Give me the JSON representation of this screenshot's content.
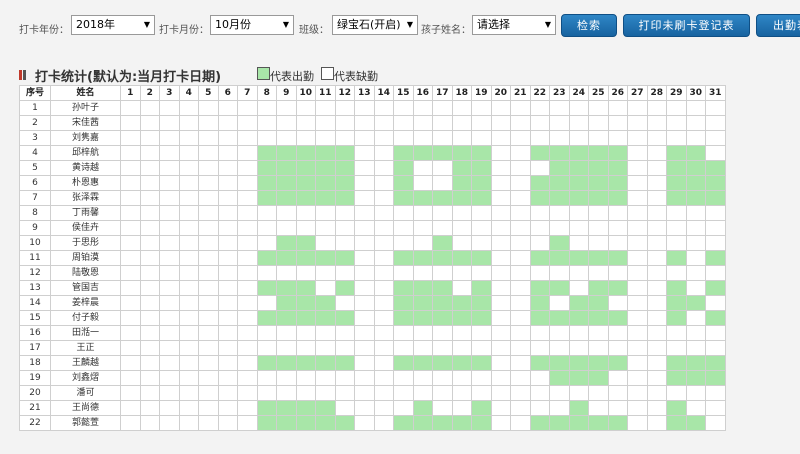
{
  "filters": {
    "year_label": "打卡年份：",
    "year_value": "2018年",
    "month_label": "打卡月份：",
    "month_value": "10月份",
    "class_label": "班级：",
    "class_value": "绿宝石(开启)",
    "child_label": "孩子姓名：",
    "child_value": "请选择"
  },
  "buttons": {
    "search": "检索",
    "print_unpunched": "打印未刷卡登记表",
    "attendance": "出勤表"
  },
  "section": {
    "title": "打卡统计(默认为:当月打卡日期)",
    "legend_present": "代表出勤",
    "legend_absent": "代表缺勤"
  },
  "colors": {
    "present": "#a8e6a8",
    "absent": "#ffffff",
    "button": "#1f6fb0",
    "marker_red": "#c0392b",
    "marker_dark": "#555555"
  },
  "table": {
    "header_index": "序号",
    "header_name": "姓名",
    "days": [
      "1",
      "2",
      "3",
      "4",
      "5",
      "6",
      "7",
      "8",
      "9",
      "10",
      "11",
      "12",
      "13",
      "14",
      "15",
      "16",
      "17",
      "18",
      "19",
      "20",
      "21",
      "22",
      "23",
      "24",
      "25",
      "26",
      "27",
      "28",
      "29",
      "30",
      "31"
    ],
    "rows": [
      {
        "index": "1",
        "name": "孙叶子",
        "present": []
      },
      {
        "index": "2",
        "name": "宋佳茜",
        "present": []
      },
      {
        "index": "3",
        "name": "刘隽嘉",
        "present": []
      },
      {
        "index": "4",
        "name": "邱梓航",
        "present": [
          8,
          9,
          10,
          11,
          12,
          15,
          16,
          17,
          18,
          19,
          22,
          23,
          24,
          25,
          26,
          29,
          30
        ]
      },
      {
        "index": "5",
        "name": "黄诗越",
        "present": [
          8,
          9,
          10,
          11,
          12,
          15,
          18,
          19,
          23,
          24,
          25,
          26,
          29,
          30,
          31
        ]
      },
      {
        "index": "6",
        "name": "朴恩惠",
        "present": [
          8,
          9,
          10,
          11,
          12,
          15,
          18,
          19,
          22,
          23,
          24,
          25,
          26,
          29,
          30,
          31
        ]
      },
      {
        "index": "7",
        "name": "张泽霖",
        "present": [
          8,
          9,
          10,
          11,
          12,
          15,
          16,
          17,
          18,
          19,
          22,
          23,
          24,
          25,
          26,
          29,
          30,
          31
        ]
      },
      {
        "index": "8",
        "name": "丁雨馨",
        "present": []
      },
      {
        "index": "9",
        "name": "侯佳卉",
        "present": []
      },
      {
        "index": "10",
        "name": "于思彤",
        "present": [
          9,
          10,
          17,
          23
        ]
      },
      {
        "index": "11",
        "name": "周铂漠",
        "present": [
          8,
          9,
          10,
          11,
          12,
          15,
          16,
          17,
          18,
          19,
          22,
          23,
          24,
          25,
          26,
          29,
          31
        ]
      },
      {
        "index": "12",
        "name": "陆敬恩",
        "present": []
      },
      {
        "index": "13",
        "name": "管国吉",
        "present": [
          8,
          9,
          10,
          12,
          15,
          16,
          17,
          19,
          22,
          23,
          25,
          26,
          29,
          31
        ]
      },
      {
        "index": "14",
        "name": "姜梓晨",
        "present": [
          9,
          10,
          11,
          15,
          16,
          17,
          18,
          19,
          22,
          24,
          25,
          29,
          30
        ]
      },
      {
        "index": "15",
        "name": "付子毅",
        "present": [
          8,
          9,
          10,
          11,
          12,
          15,
          16,
          17,
          18,
          19,
          22,
          23,
          24,
          25,
          26,
          29,
          31
        ]
      },
      {
        "index": "16",
        "name": "田湉一",
        "present": []
      },
      {
        "index": "17",
        "name": "王正",
        "present": []
      },
      {
        "index": "18",
        "name": "王麟越",
        "present": [
          8,
          9,
          10,
          11,
          12,
          15,
          16,
          17,
          18,
          19,
          22,
          23,
          24,
          25,
          26,
          29,
          30,
          31
        ]
      },
      {
        "index": "19",
        "name": "刘鑫熠",
        "present": [
          23,
          24,
          25,
          29,
          30,
          31
        ]
      },
      {
        "index": "20",
        "name": "潘可",
        "present": []
      },
      {
        "index": "21",
        "name": "王尚德",
        "present": [
          8,
          9,
          10,
          11,
          16,
          19,
          24,
          29
        ]
      },
      {
        "index": "22",
        "name": "郭懿萱",
        "present": [
          8,
          9,
          10,
          11,
          12,
          15,
          16,
          17,
          18,
          19,
          22,
          23,
          24,
          25,
          26,
          29,
          30
        ]
      }
    ]
  }
}
